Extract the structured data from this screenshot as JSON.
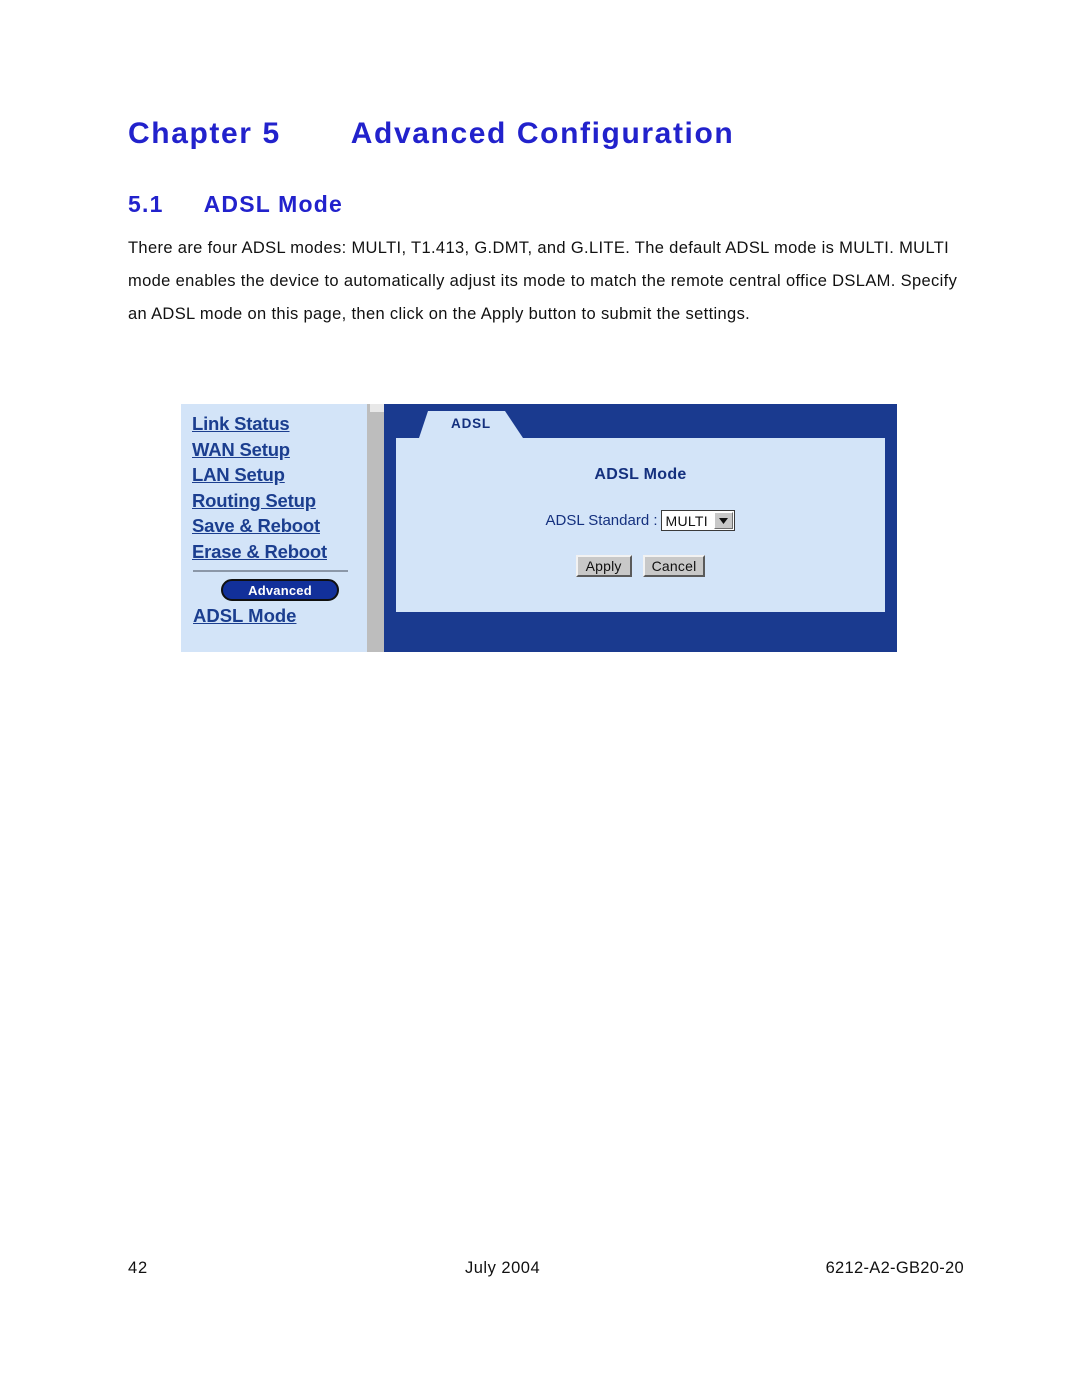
{
  "document": {
    "chapter": {
      "number": "Chapter 5",
      "title": "Advanced Configuration"
    },
    "section": {
      "number": "5.1",
      "title": "ADSL Mode"
    },
    "paragraph": "There are four ADSL modes: MULTI, T1.413, G.DMT, and G.LITE.  The default ADSL mode is MULTI.  MULTI mode enables the device to automatically adjust its mode to match the remote central office DSLAM.  Specify an ADSL mode on this page, then click on the Apply button to submit the settings."
  },
  "screenshot": {
    "sidebar": {
      "links": [
        {
          "label": "Link Status"
        },
        {
          "label": "WAN Setup"
        },
        {
          "label": "LAN Setup"
        },
        {
          "label": "Routing Setup"
        },
        {
          "label": "Save & Reboot"
        },
        {
          "label": "Erase & Reboot"
        }
      ],
      "advanced_button": "Advanced",
      "advanced_link": "ADSL Mode"
    },
    "panel": {
      "tab_label": "ADSL",
      "card_title": "ADSL Mode",
      "field_label": "ADSL Standard :",
      "field_value": "MULTI",
      "apply_label": "Apply",
      "cancel_label": "Cancel"
    }
  },
  "footer": {
    "page_number": "42",
    "date": "July 2004",
    "document_id": "6212-A2-GB20-20"
  },
  "colors": {
    "heading_blue": "#2222cc",
    "panel_dark_blue": "#1a3a8f",
    "panel_light_blue": "#d3e4f8",
    "link_blue": "#1b3e8f",
    "button_gray": "#c8c8c8"
  }
}
